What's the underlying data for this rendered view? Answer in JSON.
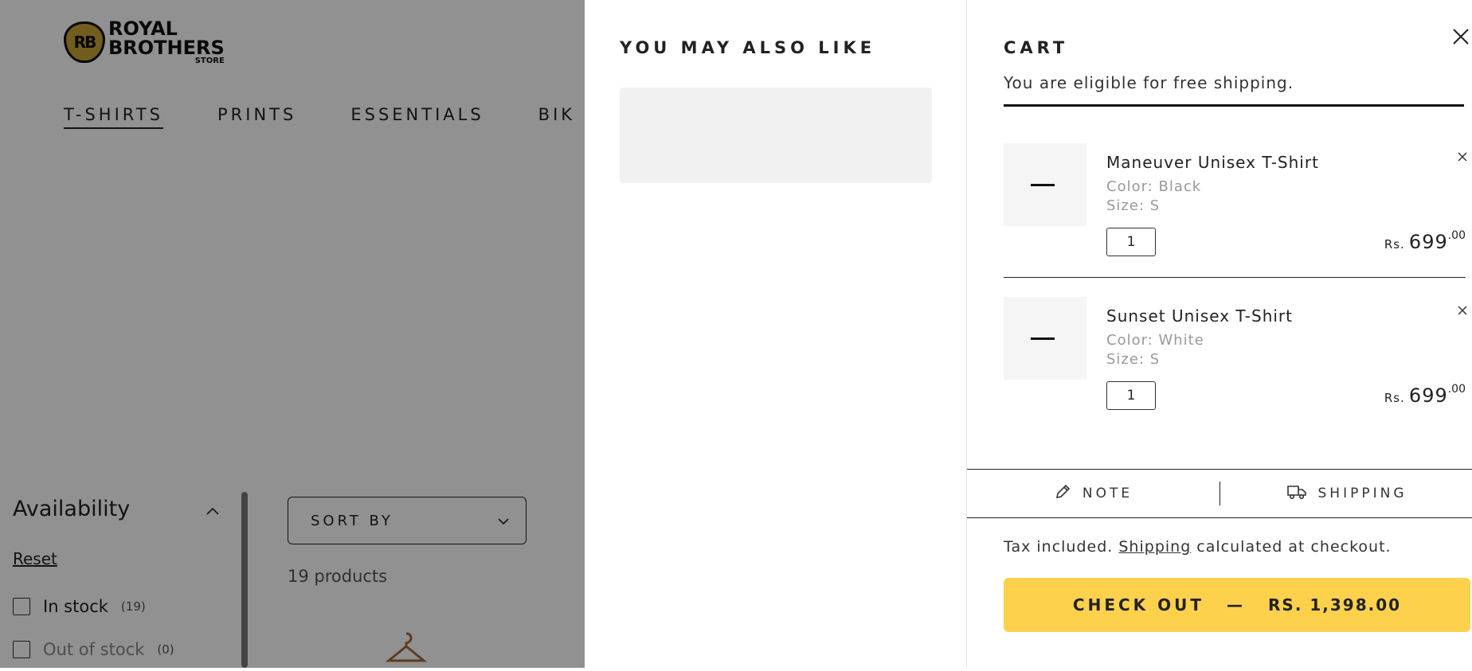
{
  "store": {
    "logo": {
      "badge": "RB",
      "line1": "ROYAL",
      "line2": "BROTHERS",
      "line3": "STORE"
    },
    "nav": [
      "T-SHIRTS",
      "PRINTS",
      "ESSENTIALS",
      "BIK"
    ],
    "filter": {
      "title": "Availability",
      "reset": "Reset",
      "options": [
        {
          "label": "In stock",
          "count": "(19)"
        },
        {
          "label": "Out of stock",
          "count": "(0)"
        }
      ]
    },
    "sort_label": "SORT BY",
    "product_count": "19 products"
  },
  "upsell": {
    "title": "YOU MAY ALSO LIKE"
  },
  "cart": {
    "title": "CART",
    "free_shipping": "You are eligible for free shipping.",
    "items": [
      {
        "name": "Maneuver Unisex T-Shirt",
        "color": "Color: Black",
        "size": "Size: S",
        "qty": "1",
        "currency": "Rs.",
        "price": "699",
        "decimals": ".00"
      },
      {
        "name": "Sunset Unisex T-Shirt",
        "color": "Color: White",
        "size": "Size: S",
        "qty": "1",
        "currency": "Rs.",
        "price": "699",
        "decimals": ".00"
      }
    ],
    "tabs": {
      "note": "NOTE",
      "shipping": "SHIPPING"
    },
    "tax_note": {
      "before": "Tax included. ",
      "link": "Shipping",
      "after": " calculated at checkout."
    },
    "checkout": {
      "label": "CHECK OUT",
      "separator": "—",
      "total": "RS. 1,398.00"
    }
  },
  "colors": {
    "checkout_bg": "#fdd14c",
    "logo_gold": "#c9a437",
    "overlay": "rgba(0,0,0,0.43)"
  },
  "icons": {
    "close": "close-icon",
    "remove": "remove-icon",
    "note": "pencil-icon",
    "shipping": "truck-icon",
    "sort": "chevron-down-icon",
    "filter_toggle": "chevron-up-icon"
  }
}
